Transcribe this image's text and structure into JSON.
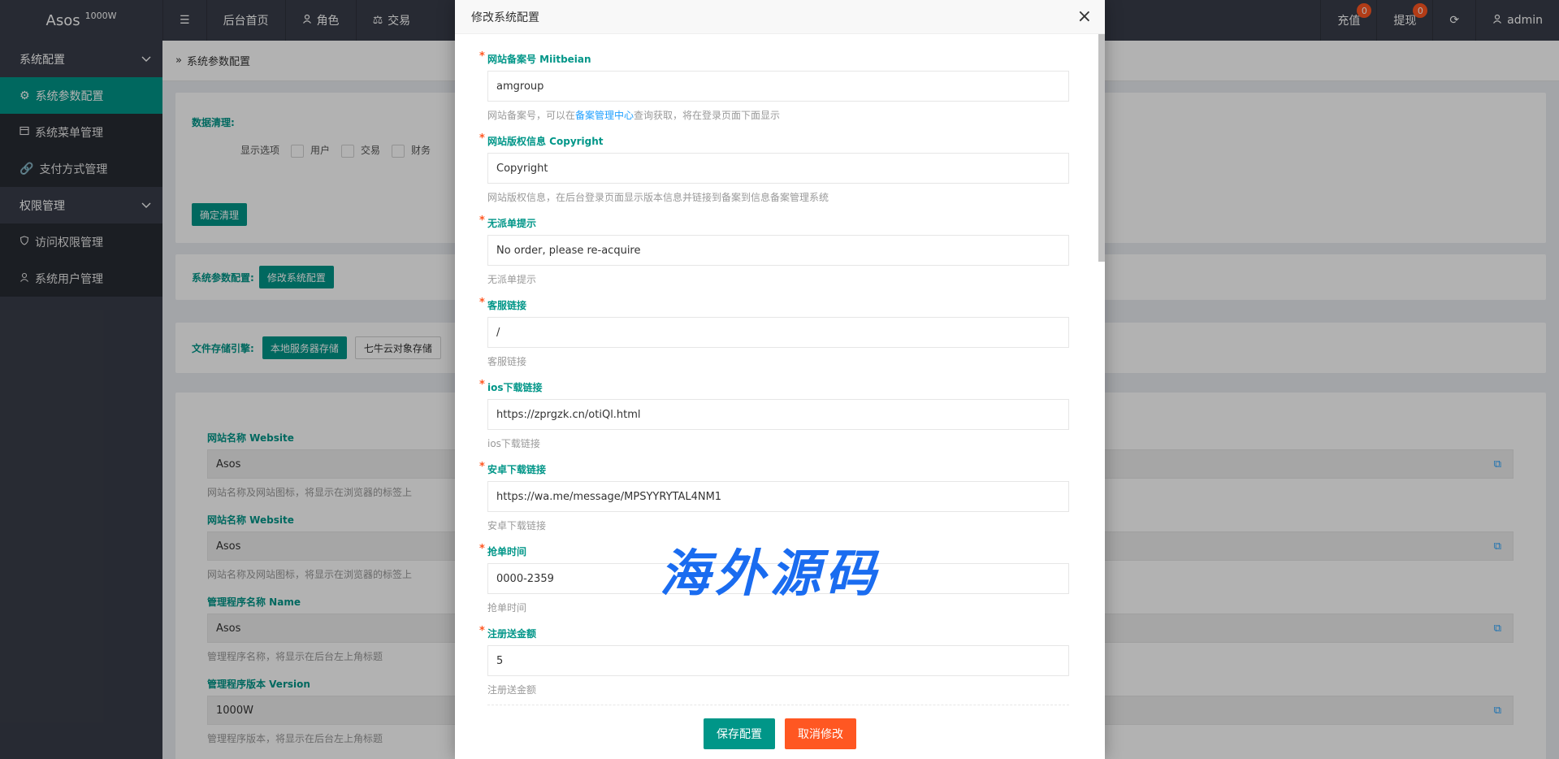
{
  "app": {
    "name": "Asos",
    "version": "1000W"
  },
  "topnav": [
    {
      "label": "后台首页",
      "icon": ""
    },
    {
      "label": "角色",
      "icon": "user-icon"
    },
    {
      "label": "交易",
      "icon": "scale-icon"
    }
  ],
  "topright": {
    "recharge": {
      "label": "充值",
      "badge": "0"
    },
    "withdraw": {
      "label": "提现",
      "badge": "0"
    },
    "user": "admin"
  },
  "sidebar": {
    "groups": [
      {
        "label": "系统配置",
        "items": [
          {
            "label": "系统参数配置",
            "icon": "gear-icon",
            "active": true
          },
          {
            "label": "系统菜单管理",
            "icon": "menu-icon"
          },
          {
            "label": "支付方式管理",
            "icon": "link-icon"
          }
        ]
      },
      {
        "label": "权限管理",
        "items": [
          {
            "label": "访问权限管理",
            "icon": "shield-icon"
          },
          {
            "label": "系统用户管理",
            "icon": "user-icon"
          }
        ]
      }
    ]
  },
  "breadcrumb": "系统参数配置",
  "clean": {
    "title": "数据清理:",
    "show_label": "显示选项",
    "options": [
      "用户",
      "交易",
      "财务"
    ],
    "confirm": "确定清理"
  },
  "sysparam": {
    "label": "系统参数配置:",
    "button": "修改系统配置"
  },
  "storage": {
    "label": "文件存储引擎:",
    "local": "本地服务器存储",
    "qiniu": "七牛云对象存储"
  },
  "bgfields": [
    {
      "title": "网站名称 Website",
      "value": "Asos",
      "hint": "网站名称及网站图标，将显示在浏览器的标签上"
    },
    {
      "title": "网站名称 Website",
      "value": "Asos",
      "hint": "网站名称及网站图标，将显示在浏览器的标签上"
    },
    {
      "title": "管理程序名称 Name",
      "value": "Asos",
      "hint": "管理程序名称，将显示在后台左上角标题"
    },
    {
      "title": "管理程序版本 Version",
      "value": "1000W",
      "hint": "管理程序版本，将显示在后台左上角标题"
    }
  ],
  "modal": {
    "title": "修改系统配置",
    "fields": [
      {
        "title": "网站备案号 Miitbeian",
        "value": "amgroup",
        "hint_pre": "网站备案号，可以在",
        "hint_link": "备案管理中心",
        "hint_post": "查询获取，将在登录页面下面显示"
      },
      {
        "title": "网站版权信息 Copyright",
        "value": "Copyright",
        "hint": "网站版权信息，在后台登录页面显示版本信息并链接到备案到信息备案管理系统"
      },
      {
        "title": "无派单提示",
        "value": "No order, please re-acquire",
        "hint": "无派单提示"
      },
      {
        "title": "客服链接",
        "value": "/",
        "hint": "客服链接"
      },
      {
        "title": "ios下载链接",
        "value": "https://zprgzk.cn/otiQl.html",
        "hint": "ios下载链接"
      },
      {
        "title": "安卓下载链接",
        "value": "https://wa.me/message/MPSYYRYTAL4NM1",
        "hint": "安卓下载链接"
      },
      {
        "title": "抢单时间",
        "value": "0000-2359",
        "hint": "抢单时间"
      },
      {
        "title": "注册送金额",
        "value": "5",
        "hint": "注册送金额"
      }
    ],
    "save": "保存配置",
    "cancel": "取消修改",
    "close": "×"
  },
  "watermark": "海外源码",
  "colors": {
    "teal": "#009688",
    "orange": "#ff5722",
    "dark": "#393d49"
  }
}
